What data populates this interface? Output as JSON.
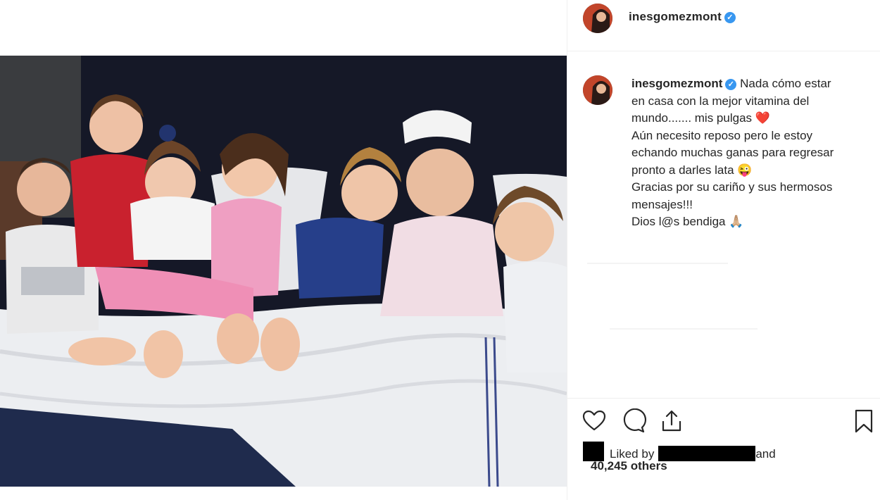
{
  "post": {
    "username": "inesgomezmont",
    "verified_mark": "✓",
    "caption_lines": [
      "Nada cómo estar",
      "en casa con la mejor vitamina del",
      "mundo....... mis pulgas ❤️",
      "Aún necesito reposo pero le estoy",
      "echando muchas ganas para regresar",
      "pronto a darles lata 😜",
      "Gracias por su cariño y sus hermosos",
      "mensajes!!!",
      "Dios l@s bendiga 🙏🏼"
    ]
  },
  "likes": {
    "prefix": "Liked by",
    "suffix": "and",
    "count_text": "40,245 others"
  },
  "icons": {
    "like": "heart-outline-icon",
    "comment": "speech-bubble-icon",
    "share": "share-upload-icon",
    "save": "bookmark-icon",
    "verified": "verified-badge-icon"
  },
  "colors": {
    "text": "#262626",
    "verified": "#3897f0",
    "divider": "#efefef",
    "redaction": "#000000"
  }
}
